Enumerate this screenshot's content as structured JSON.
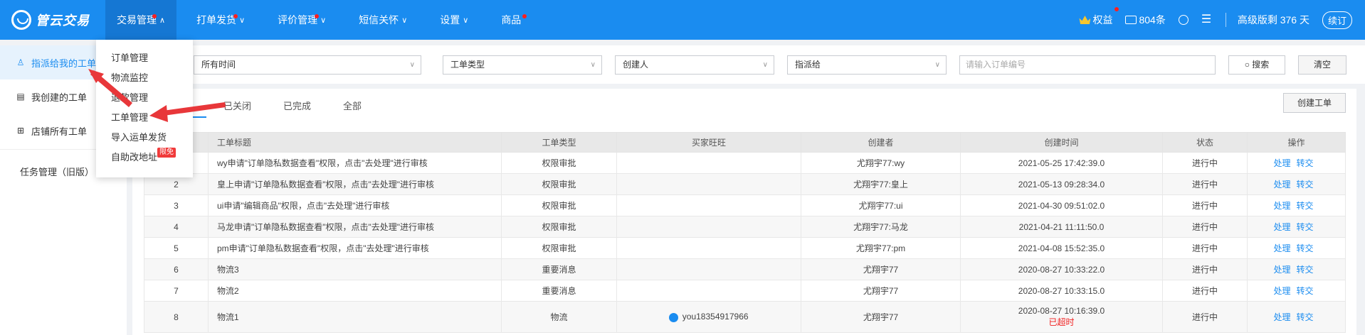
{
  "brand": {
    "name": "管云交易"
  },
  "nav": {
    "items": [
      {
        "label": "交易管理",
        "chevron": "∧",
        "dot": true
      },
      {
        "label": "打单发货",
        "chevron": "∨",
        "dot": true
      },
      {
        "label": "评价管理",
        "chevron": "∨",
        "dot": true
      },
      {
        "label": "短信关怀",
        "chevron": "∨",
        "dot": false
      },
      {
        "label": "设置",
        "chevron": "∨",
        "dot": false
      },
      {
        "label": "商品",
        "chevron": "",
        "dot": true
      }
    ]
  },
  "tools": {
    "rights": "权益",
    "mail_count": "804条",
    "plan": "高级版剩 376 天",
    "renew": "续订"
  },
  "dropdown": {
    "items": [
      "订单管理",
      "物流监控",
      "退款管理",
      "工单管理",
      "导入运单发货",
      "自助改地址"
    ],
    "badge": "限免"
  },
  "sidebar": {
    "items": [
      {
        "label": "指派给我的工单",
        "icon": "person-icon"
      },
      {
        "label": "我创建的工单",
        "icon": "document-icon"
      },
      {
        "label": "店铺所有工单",
        "icon": "grid-icon"
      }
    ],
    "legacy": "任务管理（旧版）"
  },
  "filters": {
    "time": "所有时间",
    "type": "工单类型",
    "creator": "创建人",
    "assignee": "指派给",
    "order_placeholder": "请输入订单编号",
    "search": "搜索",
    "clear": "清空"
  },
  "tabs": [
    "已关闭",
    "已完成",
    "全部"
  ],
  "create_button": "创建工单",
  "table": {
    "headers": [
      "",
      "工单标题",
      "工单类型",
      "买家旺旺",
      "创建者",
      "创建时间",
      "状态",
      "操作"
    ],
    "rows": [
      {
        "no": "",
        "title": "wy申请\"订单隐私数据查看\"权限，点击\"去处理\"进行审核",
        "type": "权限审批",
        "buyer": "",
        "creator": "尤翔宇77:wy",
        "time": "2021-05-25 17:42:39.0",
        "status": "进行中"
      },
      {
        "no": "2",
        "title": "皇上申请\"订单隐私数据查看\"权限，点击\"去处理\"进行审核",
        "type": "权限审批",
        "buyer": "",
        "creator": "尤翔宇77:皇上",
        "time": "2021-05-13 09:28:34.0",
        "status": "进行中"
      },
      {
        "no": "3",
        "title": "ui申请\"编辑商品\"权限，点击\"去处理\"进行审核",
        "type": "权限审批",
        "buyer": "",
        "creator": "尤翔宇77:ui",
        "time": "2021-04-30 09:51:02.0",
        "status": "进行中"
      },
      {
        "no": "4",
        "title": "马龙申请\"订单隐私数据查看\"权限，点击\"去处理\"进行审核",
        "type": "权限审批",
        "buyer": "",
        "creator": "尤翔宇77:马龙",
        "time": "2021-04-21 11:11:50.0",
        "status": "进行中"
      },
      {
        "no": "5",
        "title": "pm申请\"订单隐私数据查看\"权限，点击\"去处理\"进行审核",
        "type": "权限审批",
        "buyer": "",
        "creator": "尤翔宇77:pm",
        "time": "2021-04-08 15:52:35.0",
        "status": "进行中"
      },
      {
        "no": "6",
        "title": "物流3",
        "type": "重要消息",
        "buyer": "",
        "creator": "尤翔宇77",
        "time": "2020-08-27 10:33:22.0",
        "status": "进行中"
      },
      {
        "no": "7",
        "title": "物流2",
        "type": "重要消息",
        "buyer": "",
        "creator": "尤翔宇77",
        "time": "2020-08-27 10:33:15.0",
        "status": "进行中"
      },
      {
        "no": "8",
        "title": "物流1",
        "type": "物流",
        "buyer": "you18354917966",
        "creator": "尤翔宇77",
        "time": "2020-08-27 10:16:39.0",
        "status": "进行中",
        "overdue": "已超时"
      }
    ],
    "actions": {
      "handle": "处理",
      "transfer": "转交"
    }
  }
}
